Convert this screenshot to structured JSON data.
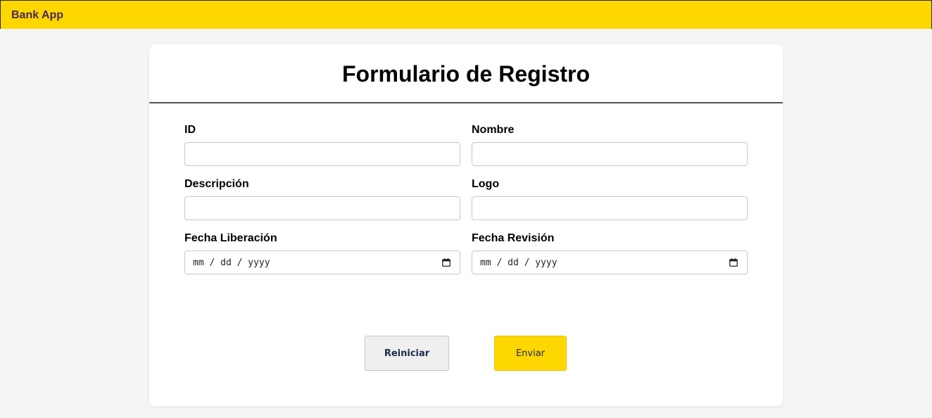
{
  "header": {
    "brand": "Bank App"
  },
  "form": {
    "title": "Formulario de Registro",
    "fields": {
      "id": {
        "label": "ID",
        "value": ""
      },
      "nombre": {
        "label": "Nombre",
        "value": ""
      },
      "descripcion": {
        "label": "Descripción",
        "value": ""
      },
      "logo": {
        "label": "Logo",
        "value": ""
      },
      "fecha_liberacion": {
        "label": "Fecha Liberación",
        "placeholder": "mm / dd / yyyy"
      },
      "fecha_revision": {
        "label": "Fecha Revisión",
        "placeholder": "mm / dd / yyyy"
      }
    },
    "buttons": {
      "reset_label": "Reiniciar",
      "submit_label": "Enviar"
    }
  },
  "icons": {
    "date_picker": "calendar-icon"
  },
  "colors": {
    "accent": "#ffd700",
    "brand_text": "#4a2a5a",
    "page_background": "#f4f5f7"
  }
}
